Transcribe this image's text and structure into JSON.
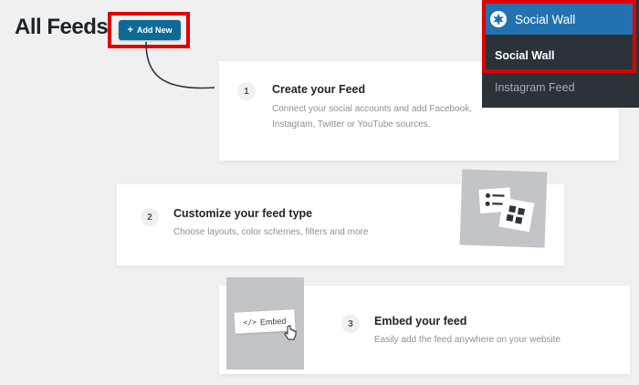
{
  "page": {
    "title": "All Feeds"
  },
  "header": {
    "add_new_label": "Add New",
    "add_new_icon": "plus-icon"
  },
  "admin_menu": {
    "head_label": "Social Wall",
    "head_icon": "social-wall-logo-icon",
    "items": [
      {
        "label": "Social Wall",
        "active": true
      },
      {
        "label": "Instagram Feed",
        "active": false
      }
    ]
  },
  "steps": [
    {
      "number": "1",
      "title": "Create your Feed",
      "description_lines": [
        "Connect your social accounts and add Facebook,",
        "Instagram, Twitter or YouTube sources."
      ]
    },
    {
      "number": "2",
      "title": "Customize your feed type",
      "description_lines": [
        "Choose layouts, color schemes, filters and more"
      ]
    },
    {
      "number": "3",
      "title": "Embed your feed",
      "description_lines": [
        "Easily add the feed anywhere on your website"
      ],
      "embed_chip_label": "Embed",
      "embed_chip_icon": "code-icon"
    }
  ],
  "colors": {
    "highlight": "#e00000",
    "primary_button": "#0d6a97",
    "menu_active": "#2271b1",
    "menu_bg": "#2c3338"
  }
}
